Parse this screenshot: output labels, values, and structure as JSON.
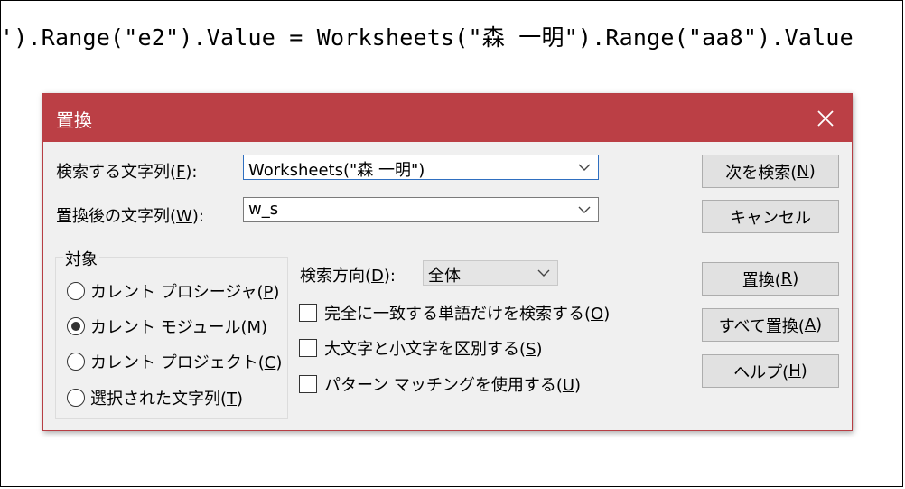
{
  "code_line": "').Range(\"e2\").Value = Worksheets(\"森 一明\").Range(\"aa8\").Value",
  "dialog": {
    "title": "置換",
    "find": {
      "label": "検索する文字列(",
      "key": "F",
      "suffix": "):",
      "value": "Worksheets(\"森 一明\")"
    },
    "replace": {
      "label": "置換後の文字列(",
      "key": "W",
      "suffix": "):",
      "value": "w_s"
    },
    "scope": {
      "title": "対象",
      "options": [
        {
          "label": "カレント プロシージャ(",
          "key": "P",
          "suffix": ")",
          "selected": false
        },
        {
          "label": "カレント モジュール(",
          "key": "M",
          "suffix": ")",
          "selected": true
        },
        {
          "label": "カレント プロジェクト(",
          "key": "C",
          "suffix": ")",
          "selected": false
        },
        {
          "label": "選択された文字列(",
          "key": "T",
          "suffix": ")",
          "selected": false
        }
      ]
    },
    "direction": {
      "label": "検索方向(",
      "key": "D",
      "suffix": "):",
      "value": "全体"
    },
    "checkboxes": [
      {
        "label": "完全に一致する単語だけを検索する(",
        "key": "O",
        "suffix": ")",
        "checked": false
      },
      {
        "label": "大文字と小文字を区別する(",
        "key": "S",
        "suffix": ")",
        "checked": false
      },
      {
        "label": "パターン マッチングを使用する(",
        "key": "U",
        "suffix": ")",
        "checked": false
      }
    ],
    "buttons": {
      "find_next": {
        "label": "次を検索(",
        "key": "N",
        "suffix": ")"
      },
      "cancel": {
        "label": "キャンセル"
      },
      "replace": {
        "label": "置換(",
        "key": "R",
        "suffix": ")"
      },
      "replace_all": {
        "label": "すべて置換(",
        "key": "A",
        "suffix": ")"
      },
      "help": {
        "label": "ヘルプ(",
        "key": "H",
        "suffix": ")"
      }
    },
    "colors": {
      "titlebar": "#bb3f45",
      "dialog_bg": "#f0f0f0",
      "button_bg": "#e1e1e1"
    },
    "icons": {
      "close": "close-icon",
      "dropdown": "chevron-down-icon"
    }
  }
}
